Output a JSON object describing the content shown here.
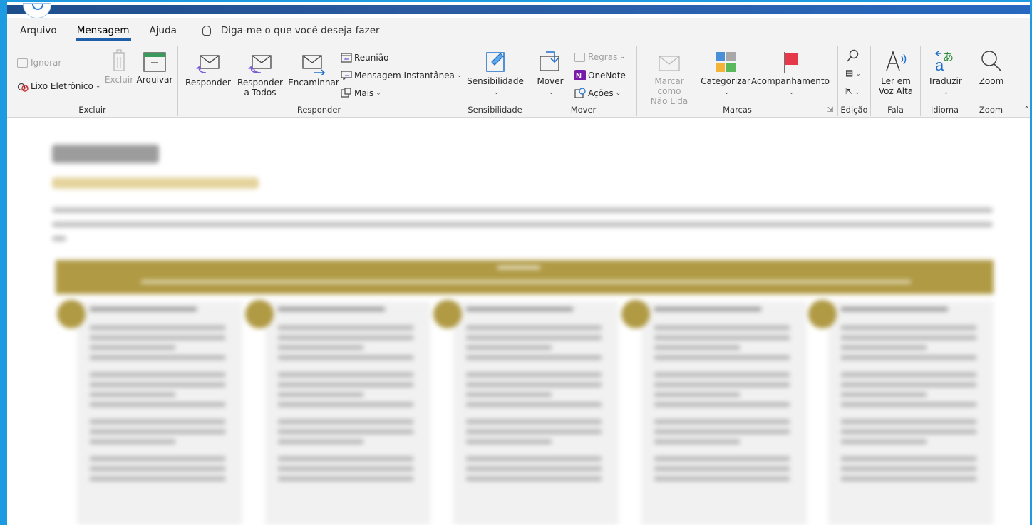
{
  "menu": {
    "items": [
      "Arquivo",
      "Mensagem",
      "Ajuda"
    ],
    "active": "Mensagem",
    "tell_me": "Diga-me o que você deseja fazer"
  },
  "ribbon": {
    "excluir": {
      "label": "Excluir",
      "ignorar": "Ignorar",
      "lixo": "Lixo Eletrônico",
      "excluir_btn": "Excluir",
      "arquivar": "Arquivar"
    },
    "responder": {
      "label": "Responder",
      "responder": "Responder",
      "responder_todos_1": "Responder",
      "responder_todos_2": "a Todos",
      "encaminhar": "Encaminhar",
      "reuniao": "Reunião",
      "mensagem_instantanea": "Mensagem Instantânea",
      "mais": "Mais"
    },
    "sensibilidade": {
      "label": "Sensibilidade",
      "btn": "Sensibilidade"
    },
    "mover": {
      "label": "Mover",
      "mover": "Mover",
      "regras": "Regras",
      "onenote": "OneNote",
      "acoes": "Ações"
    },
    "marcas": {
      "label": "Marcas",
      "marcar_1": "Marcar como",
      "marcar_2": "Não Lida",
      "categorizar": "Categorizar",
      "acompanhamento": "Acompanhamento"
    },
    "edicao": {
      "label": "Edição"
    },
    "fala": {
      "label": "Fala",
      "ler_1": "Ler em",
      "ler_2": "Voz Alta"
    },
    "idioma": {
      "label": "Idioma",
      "traduzir": "Traduzir"
    },
    "zoom": {
      "label": "Zoom",
      "zoom": "Zoom"
    }
  },
  "colors": {
    "accent": "#1e9be0",
    "tab_underline": "#1f5ea8",
    "gold": "#b09a44"
  },
  "icons": [
    "archive-icon",
    "delete-icon",
    "ignore-icon",
    "junk-icon",
    "reply-icon",
    "reply-all-icon",
    "forward-icon",
    "meeting-icon",
    "im-icon",
    "more-icon",
    "sensitivity-icon",
    "move-icon",
    "rules-icon",
    "onenote-icon",
    "actions-icon",
    "mark-unread-icon",
    "categorize-icon",
    "flag-icon",
    "search-icon",
    "select-icon",
    "read-aloud-icon",
    "translate-icon",
    "zoom-icon",
    "lightbulb-icon"
  ]
}
